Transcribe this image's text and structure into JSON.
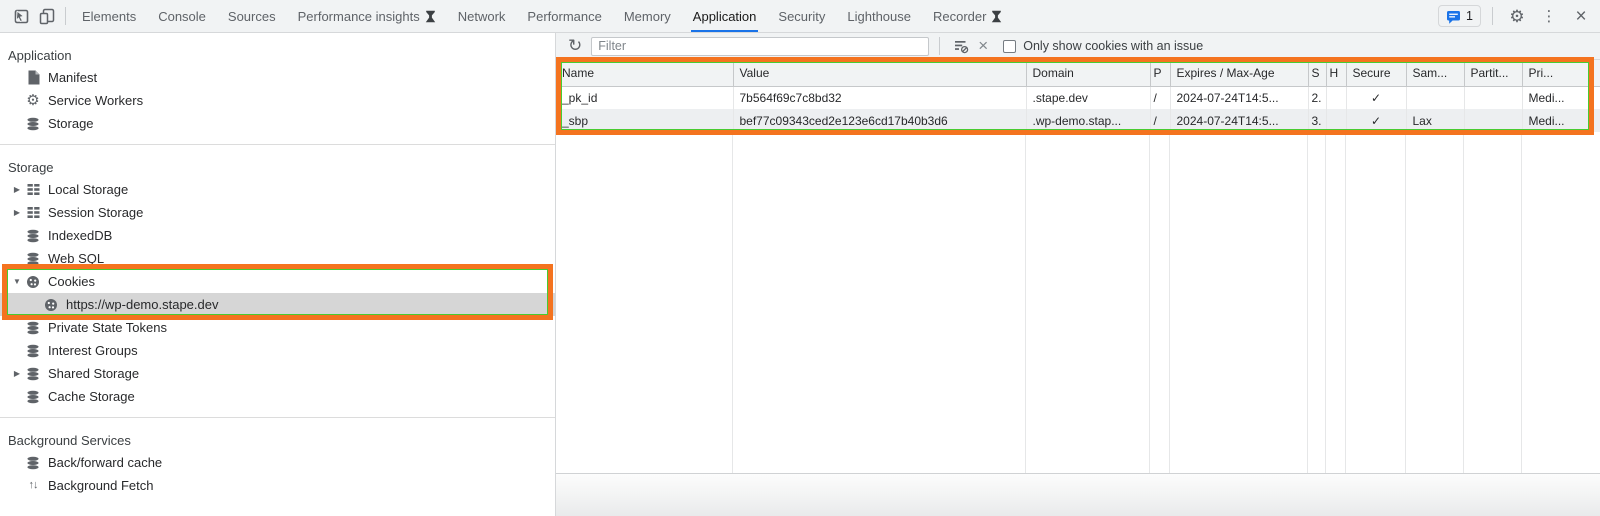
{
  "tabbar": {
    "tabs": [
      {
        "label": "Elements"
      },
      {
        "label": "Console"
      },
      {
        "label": "Sources"
      },
      {
        "label": "Performance insights"
      },
      {
        "label": "Network"
      },
      {
        "label": "Performance"
      },
      {
        "label": "Memory"
      },
      {
        "label": "Application"
      },
      {
        "label": "Security"
      },
      {
        "label": "Lighthouse"
      },
      {
        "label": "Recorder"
      }
    ],
    "issues_count": "1"
  },
  "sidebar": {
    "sections": [
      {
        "title": "Application",
        "items": [
          {
            "label": "Manifest"
          },
          {
            "label": "Service Workers"
          },
          {
            "label": "Storage"
          }
        ]
      },
      {
        "title": "Storage",
        "items": [
          {
            "label": "Local Storage"
          },
          {
            "label": "Session Storage"
          },
          {
            "label": "IndexedDB"
          },
          {
            "label": "Web SQL"
          },
          {
            "label": "Cookies"
          },
          {
            "label": "https://wp-demo.stape.dev"
          },
          {
            "label": "Private State Tokens"
          },
          {
            "label": "Interest Groups"
          },
          {
            "label": "Shared Storage"
          },
          {
            "label": "Cache Storage"
          }
        ]
      },
      {
        "title": "Background Services",
        "items": [
          {
            "label": "Back/forward cache"
          },
          {
            "label": "Background Fetch"
          }
        ]
      }
    ]
  },
  "toolbar": {
    "filter_placeholder": "Filter",
    "checkbox_label": "Only show cookies with an issue"
  },
  "table": {
    "columns": [
      "Name",
      "Value",
      "Domain",
      "P",
      "Expires / Max-Age",
      "S",
      "H",
      "Secure",
      "Sam...",
      "Partit...",
      "Pri..."
    ],
    "rows": [
      {
        "name": "_pk_id",
        "value": "7b564f69c7c8bd32",
        "domain": ".stape.dev",
        "path": "/",
        "expires": "2024-07-24T14:5...",
        "size": "2.",
        "http": "",
        "secure": "✓",
        "samesite": "",
        "partition": "",
        "priority": "Medi..."
      },
      {
        "name": "_sbp",
        "value": "bef77c09343ced2e123e6cd17b40b3d6",
        "domain": ".wp-demo.stap...",
        "path": "/",
        "expires": "2024-07-24T14:5...",
        "size": "3.",
        "http": "",
        "secure": "✓",
        "samesite": "Lax",
        "partition": "",
        "priority": "Medi..."
      }
    ]
  },
  "colors": {
    "highlight_orange": "#f4731f",
    "accent_blue": "#1a73e8"
  }
}
